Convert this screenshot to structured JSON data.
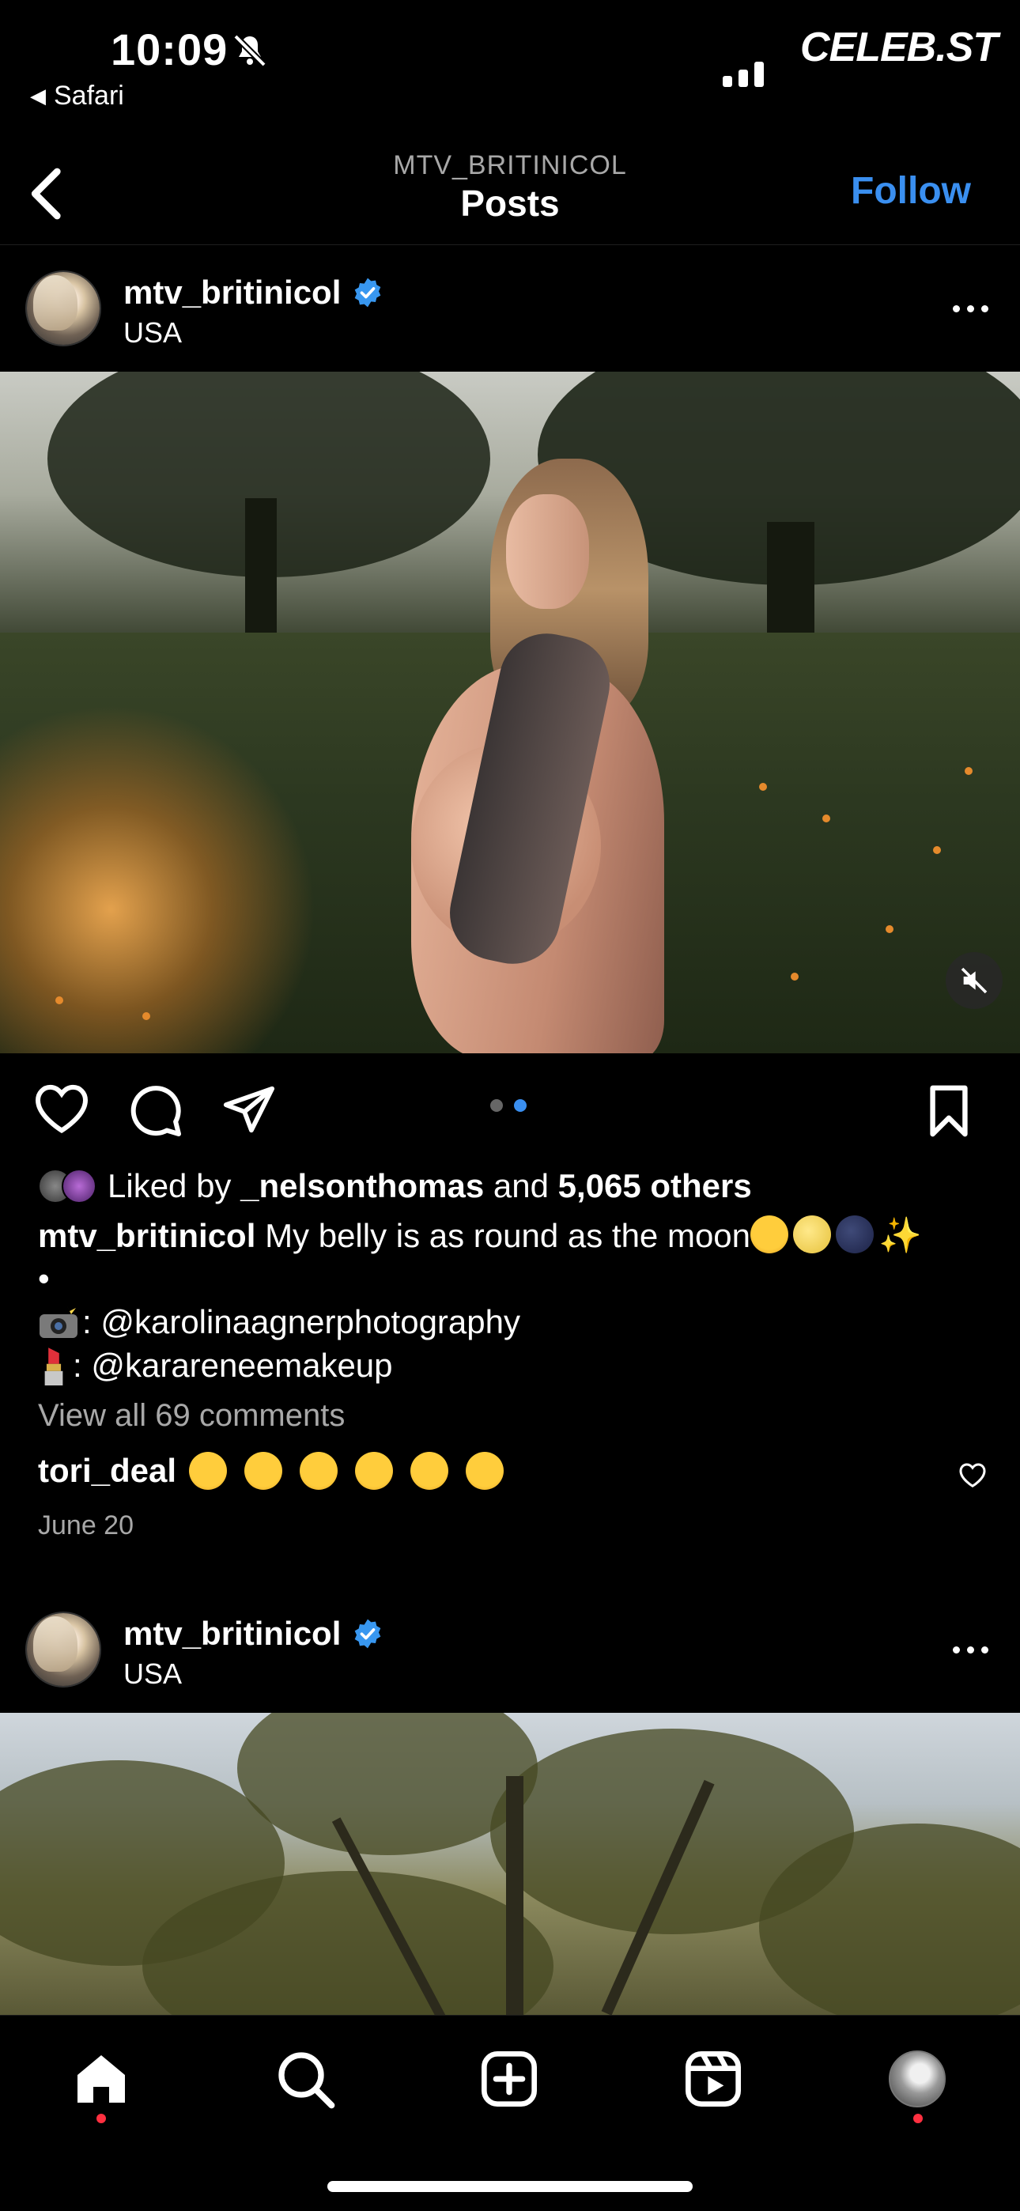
{
  "status_bar": {
    "time": "10:09",
    "back_app": "Safari",
    "brand": "CELEB.ST"
  },
  "header": {
    "subtitle": "MTV_BRITINICOL",
    "title": "Posts",
    "follow_label": "Follow"
  },
  "posts": [
    {
      "username": "mtv_britinicol",
      "location": "USA",
      "liked_by_prefix": "Liked by",
      "liked_by_user": "_nelsonthomas",
      "liked_by_and": "and",
      "liked_by_count": "5,065 others",
      "caption_user": "mtv_britinicol",
      "caption_text": "My belly is as round as the moon",
      "caption_bullet": "•",
      "credit_photo": ": @karolinaagnerphotography",
      "credit_makeup": ": @karareneemakeup",
      "view_all": "View all 69 comments",
      "comment_user": "tori_deal",
      "date": "June 20",
      "carousel_active": 2,
      "carousel_total": 2
    },
    {
      "username": "mtv_britinicol",
      "location": "USA"
    }
  ],
  "tabs": [
    "home",
    "search",
    "create",
    "reels",
    "profile"
  ],
  "colors": {
    "accent": "#3a8ff0",
    "notification": "#ff3040",
    "verified": "#3897f0"
  }
}
